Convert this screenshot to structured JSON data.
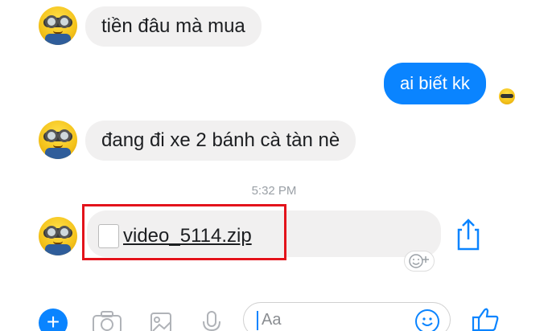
{
  "messages": [
    {
      "direction": "incoming",
      "text": "tiền đâu mà mua"
    },
    {
      "direction": "outgoing",
      "text": "ai biết kk"
    },
    {
      "direction": "incoming",
      "text": "đang đi xe 2 bánh cà tàn nè"
    }
  ],
  "timestamp": "5:32 PM",
  "file_message": {
    "file_name": "video_5114.zip"
  },
  "composer": {
    "placeholder": "Aa"
  },
  "icons": {
    "add": "plus-icon",
    "camera": "camera-icon",
    "gallery": "image-icon",
    "voice": "microphone-icon",
    "emoji": "smiley-icon",
    "like": "thumbs-up-icon",
    "share": "share-icon",
    "react": "add-reaction-icon"
  },
  "colors": {
    "accent": "#0a84ff",
    "incoming_bubble": "#f1f0f0",
    "highlight_box": "#e3131b"
  }
}
